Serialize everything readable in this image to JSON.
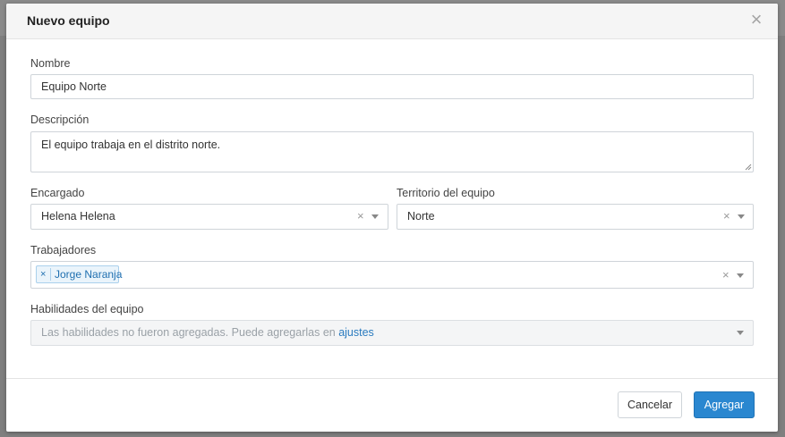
{
  "dialog": {
    "title": "Nuevo equipo",
    "close_symbol": "×"
  },
  "form": {
    "nombre": {
      "label": "Nombre",
      "value": "Equipo Norte"
    },
    "descripcion": {
      "label": "Descripción",
      "value": "El equipo trabaja en el distrito norte."
    },
    "encargado": {
      "label": "Encargado",
      "value": "Helena Helena",
      "clear_symbol": "×"
    },
    "territorio": {
      "label": "Territorio del equipo",
      "value": "Norte",
      "clear_symbol": "×"
    },
    "trabajadores": {
      "label": "Trabajadores",
      "clear_symbol": "×",
      "tags": [
        {
          "label": "Jorge Naranja",
          "remove_symbol": "×"
        }
      ]
    },
    "habilidades": {
      "label": "Habilidades del equipo",
      "placeholder_text": "Las habilidades no fueron agregadas. Puede agregarlas en",
      "link_text": "ajustes"
    }
  },
  "footer": {
    "cancel_label": "Cancelar",
    "submit_label": "Agregar"
  },
  "colors": {
    "primary": "#2a87d0",
    "tag_text": "#1f6fb0",
    "link": "#2a7bbf"
  }
}
